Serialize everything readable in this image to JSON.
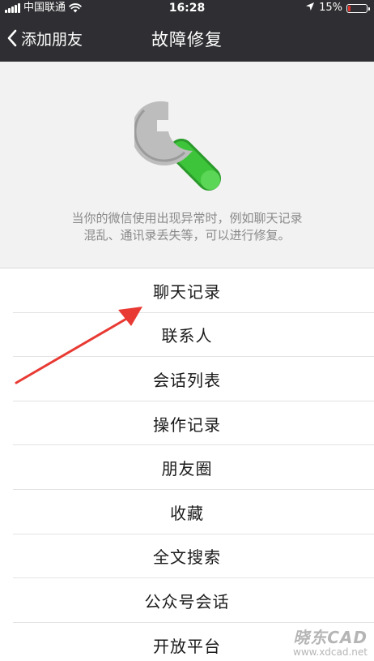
{
  "status_bar": {
    "carrier": "中国联通",
    "time": "16:28",
    "battery_percent": "15%",
    "battery_level": 0.15,
    "battery_color": "#e0322c"
  },
  "nav": {
    "back_label": "添加朋友",
    "back_icon": "chevron-left-icon",
    "title": "故障修复"
  },
  "hero": {
    "icon": "wrench-icon",
    "icon_color_metal": "#b9b9b9",
    "icon_color_handle": "#3ec43a",
    "description_line1": "当你的微信使用出现异常时，例如聊天记录",
    "description_line2": "混乱、通讯录丢失等，可以进行修复。"
  },
  "list": {
    "items": [
      {
        "label": "聊天记录"
      },
      {
        "label": "联系人"
      },
      {
        "label": "会话列表"
      },
      {
        "label": "操作记录"
      },
      {
        "label": "朋友圈"
      },
      {
        "label": "收藏"
      },
      {
        "label": "全文搜索"
      },
      {
        "label": "公众号会话"
      },
      {
        "label": "开放平台"
      }
    ]
  },
  "annotation": {
    "icon": "red-arrow-icon",
    "color": "#e83a33"
  },
  "watermark": {
    "brand": "晓东CAD",
    "url": "www.xdcad.net"
  },
  "colors": {
    "topbar": "#2f2f33",
    "background": "#f2f2f2",
    "list_background": "#ffffff",
    "description_text": "#8a8a8a"
  }
}
